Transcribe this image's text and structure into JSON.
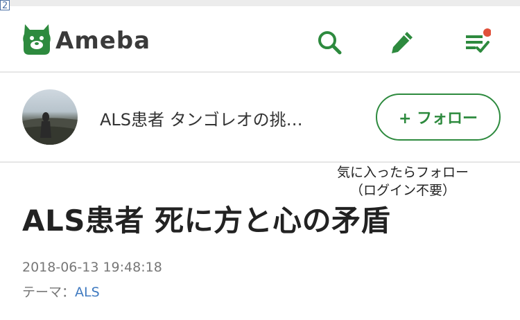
{
  "tab_number": "2",
  "header": {
    "logo_text": "Ameba",
    "icons": [
      "search-icon",
      "pen-icon",
      "checklist-icon"
    ],
    "brand_color": "#2d8a3e",
    "notification_dot_color": "#e0503a"
  },
  "profile": {
    "blog_title": "ALS患者 タンゴレオの挑…",
    "follow_label": "+ フォロー"
  },
  "annotation": {
    "line1": "気に入ったらフォロー",
    "line2": "（ログイン不要）"
  },
  "entry": {
    "title": "ALS患者 死に方と心の矛盾",
    "date": "2018-06-13 19:48:18",
    "theme_label": "テーマ：",
    "theme_value": "ALS"
  }
}
